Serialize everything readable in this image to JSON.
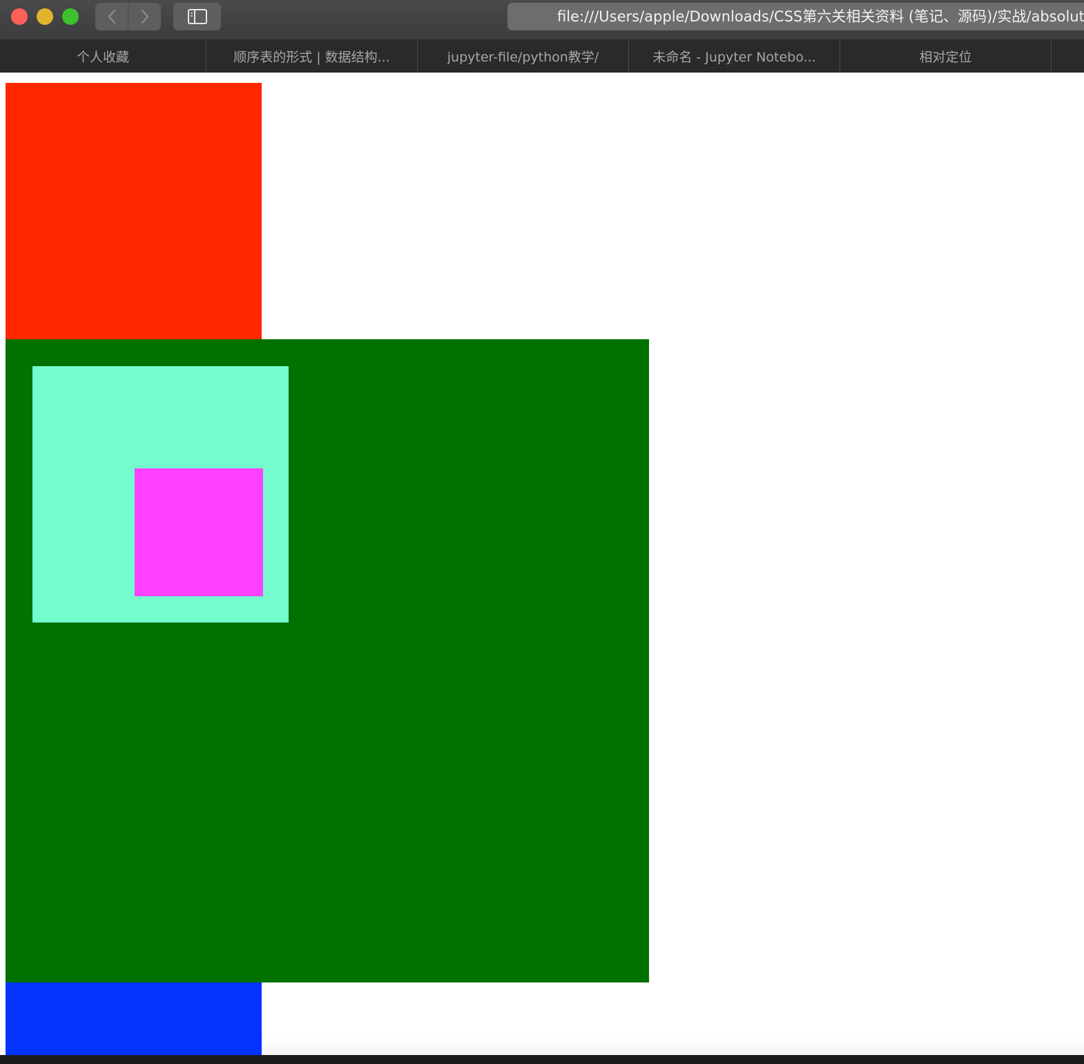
{
  "window": {
    "url": "file:///Users/apple/Downloads/CSS第六关相关资料 (笔记、源码)/实战/absolute定位.html"
  },
  "tabs": [
    {
      "label": "个人收藏"
    },
    {
      "label": "顺序表的形式 | 数据结构..."
    },
    {
      "label": "jupyter-file/python教学/"
    },
    {
      "label": "未命名 - Jupyter Notebo..."
    },
    {
      "label": "相对定位"
    }
  ],
  "icons": {
    "close": "close-icon",
    "minimize": "minimize-icon",
    "zoom": "zoom-icon",
    "back": "chevron-left-icon",
    "forward": "chevron-right-icon",
    "sidebar": "sidebar-icon"
  },
  "colors": {
    "traffic_red": "#fe5f57",
    "traffic_yellow": "#e2b32d",
    "traffic_green": "#3ec12f",
    "box1": "#ff2600",
    "box2": "#017100",
    "box3": "#73fccd",
    "box4": "#ff40ff",
    "box5": "#0433ff"
  }
}
